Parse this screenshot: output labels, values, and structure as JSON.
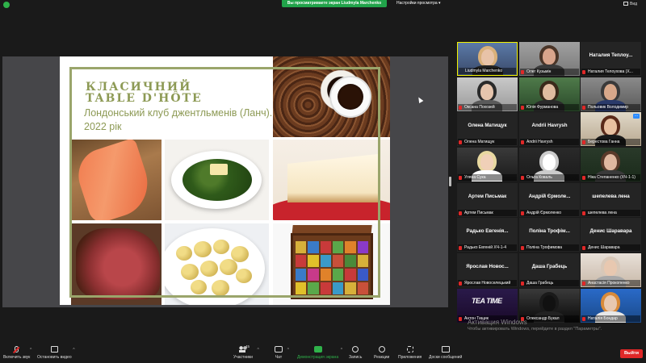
{
  "top": {
    "share_banner": "Вы просматриваете экран Liudmyla Marchenko",
    "view_settings": "Настройки просмотра",
    "view_settings_caret": "▾",
    "view_button": "Вид"
  },
  "slide": {
    "title_line1": "КЛАСИЧНИЙ",
    "title_line2": "TABLE D'HÔTE",
    "subtitle": "Лондонський клуб джентльменів (Ланч). 2022 рік"
  },
  "participants": [
    {
      "label": "Liudmyla Marchenko",
      "video": true,
      "speaking": true,
      "muted": false
    },
    {
      "label": "Олег Кузьмін",
      "video": true,
      "muted": true
    },
    {
      "label": "Наталия Телоухова (Х...",
      "name": "Наталия  Теплоу...",
      "video": false,
      "muted": true
    },
    {
      "label": "Оксана Похозей",
      "video": true,
      "muted": true
    },
    {
      "label": "Юлія Фурманова",
      "video": true,
      "muted": true
    },
    {
      "label": "Польовик Володимир",
      "video": true,
      "muted": true
    },
    {
      "label": "Олена Матищук",
      "name": "Олена Матищук",
      "video": false,
      "muted": true
    },
    {
      "label": "Andrii Havrysh",
      "name": "Andrii Havrysh",
      "video": false,
      "muted": true
    },
    {
      "label": "Берестова Ганна",
      "video": true,
      "muted": true,
      "more": "···"
    },
    {
      "label": "Уляна Сука",
      "video": true,
      "muted": true
    },
    {
      "label": "Ольга Коваль",
      "video": true,
      "muted": true
    },
    {
      "label": "Ніка Степаненко (ХЧ-1-1)",
      "video": true,
      "muted": true
    },
    {
      "label": "Артем Письмак",
      "name": "Артем Письмак",
      "video": false,
      "muted": true
    },
    {
      "label": "Андрій Єрмоленко",
      "name": "Андрій  Єрмоле...",
      "video": false,
      "muted": true
    },
    {
      "label": "шепелева лена",
      "name": "шепелева лена",
      "video": false,
      "muted": true
    },
    {
      "label": "Радько Евгеній ХЧ-1-4",
      "name": "Радько  Евгенія...",
      "video": false,
      "muted": true
    },
    {
      "label": "Поліна Трофимова",
      "name": "Поліна  Трофім...",
      "video": false,
      "muted": true
    },
    {
      "label": "Денис Шаравара",
      "name": "Денис Шаравара",
      "video": false,
      "muted": true
    },
    {
      "label": "Ярослав Новоселецький",
      "name": "Ярослав  Новос...",
      "video": false,
      "muted": true
    },
    {
      "label": "Даша Грабець",
      "name": "Даша Грабець",
      "video": false,
      "muted": true
    },
    {
      "label": "Анастасія Прокопенко",
      "video": true,
      "muted": true
    },
    {
      "label": "Антон Тищик",
      "video": true,
      "muted": true,
      "overlay": "TEA TIME"
    },
    {
      "label": "Олександр Букал",
      "video": true,
      "muted": true
    },
    {
      "label": "Наталія Бондар",
      "video": true,
      "muted": true
    }
  ],
  "windows_activation": {
    "title": "Активация Windows",
    "text": "Чтобы активировать Windows, перейдите в раздел \"Параметры\"."
  },
  "toolbar": {
    "mic": "Включить звук",
    "video": "Остановить видео",
    "participants": "Участники",
    "participants_count": "45",
    "chat": "Чат",
    "share": "Демонстрация экрана",
    "record": "Запись",
    "reactions": "Реакции",
    "apps": "Приложения",
    "whiteboards": "Доски сообщений",
    "leave": "Выйти",
    "caret": "^"
  },
  "colors": {
    "accent_green": "#21a34a",
    "slide_olive": "#8d9a55",
    "speaking_border": "#f2f200",
    "leave_red": "#e02828"
  }
}
